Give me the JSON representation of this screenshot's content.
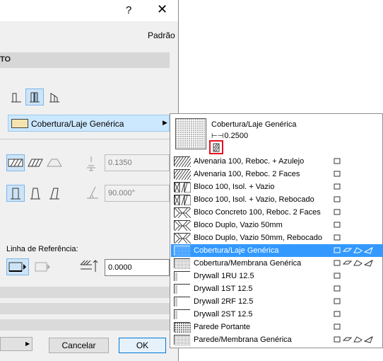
{
  "window": {
    "help_label": "?",
    "close_label": "✕",
    "defaults_label": "Padrão",
    "section_header": "TO"
  },
  "properties": {
    "material_selected": "Cobertura/Laje Genérica",
    "thickness_value": "0.1350",
    "angle_value": "90.000°",
    "reference_line_label": "Linha de Referência:",
    "offset_value": "0.0000"
  },
  "buttons": {
    "cancel": "Cancelar",
    "ok": "OK"
  },
  "popup": {
    "preview_name": "Cobertura/Laje Genérica",
    "preview_thickness": "0.2500",
    "items": [
      {
        "label": "Alvenaria 100, Reboc. + Azulejo",
        "pattern": "diag",
        "selected": false
      },
      {
        "label": "Alvenaria 100, Reboc. 2 Faces",
        "pattern": "diag",
        "selected": false
      },
      {
        "label": "Bloco 100, Isol. + Vazio",
        "pattern": "cross-box",
        "selected": false
      },
      {
        "label": "Bloco 100, Isol. + Vazio, Rebocado",
        "pattern": "cross-box",
        "selected": false
      },
      {
        "label": "Bloco Concreto 100, Reboc. 2 Faces",
        "pattern": "x-box",
        "selected": false
      },
      {
        "label": "Bloco Duplo, Vazio 50mm",
        "pattern": "x-box",
        "selected": false
      },
      {
        "label": "Bloco Duplo, Vazio 50mm, Rebocado",
        "pattern": "x-box",
        "selected": false
      },
      {
        "label": "Cobertura/Laje Genérica",
        "pattern": "dots",
        "selected": true
      },
      {
        "label": "Cobertura/Membrana Genérica",
        "pattern": "dots",
        "selected": false
      },
      {
        "label": "Drywall 1RU 12.5",
        "pattern": "drywall",
        "selected": false
      },
      {
        "label": "Drywall 1ST 12.5",
        "pattern": "drywall",
        "selected": false
      },
      {
        "label": "Drywall 2RF 12.5",
        "pattern": "drywall",
        "selected": false
      },
      {
        "label": "Drywall 2ST 12.5",
        "pattern": "drywall",
        "selected": false
      },
      {
        "label": "Parede Portante",
        "pattern": "heavy-dots",
        "selected": false
      },
      {
        "label": "Parede/Membrana Genérica",
        "pattern": "dots",
        "selected": false
      }
    ]
  },
  "icons": [
    "help-icon",
    "close-icon",
    "wall-geometry-icon",
    "hatch-fill-icon",
    "thickness-icon",
    "slant-angle-icon",
    "reference-line-icon",
    "offset-icon",
    "chevron-right-icon",
    "wall-icon",
    "slab-icon",
    "roof-icon",
    "mesh-icon"
  ],
  "colors": {
    "selection": "#3399ff",
    "dropdown_highlight": "#cce8ff",
    "material_swatch": "#f5e3b0",
    "focus_border": "#e81123",
    "ok_border": "#0078d7"
  }
}
